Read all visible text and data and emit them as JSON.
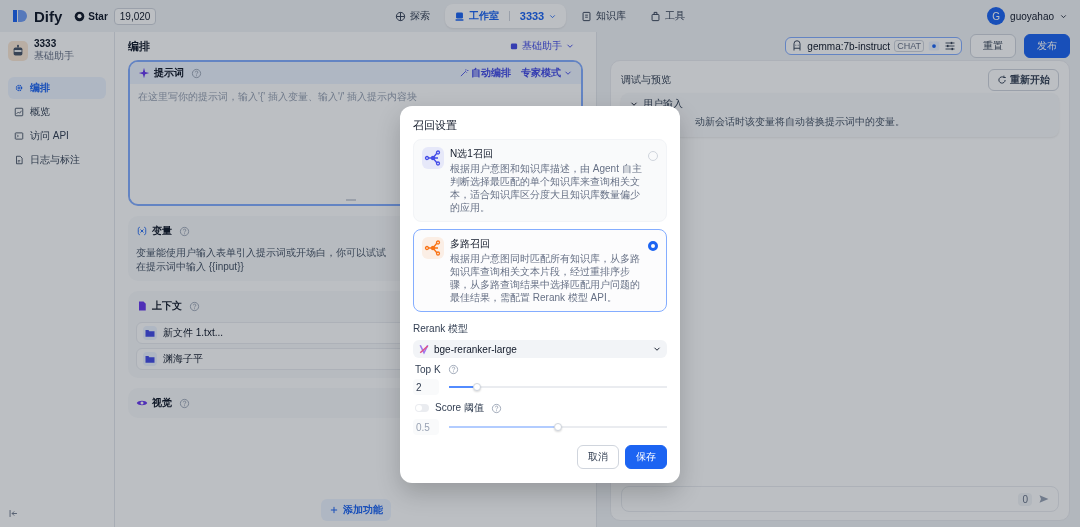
{
  "topbar": {
    "brand": "Dify",
    "star_label": "Star",
    "star_count": "19,020",
    "nav": [
      {
        "label": "探索",
        "selected": false,
        "kind": "explore"
      },
      {
        "label": "工作室",
        "selected": true,
        "kind": "studio",
        "app": "3333"
      },
      {
        "label": "知识库",
        "selected": false,
        "kind": "knowledge"
      },
      {
        "label": "工具",
        "selected": false,
        "kind": "tools"
      }
    ],
    "user": {
      "initial": "G",
      "name": "guoyahao"
    }
  },
  "app": {
    "name": "3333",
    "type": "基础助手"
  },
  "sidebar": {
    "items": [
      {
        "label": "编排",
        "selected": true,
        "kind": "orchestrate"
      },
      {
        "label": "概览",
        "selected": false,
        "kind": "overview"
      },
      {
        "label": "访问 API",
        "selected": false,
        "kind": "api"
      },
      {
        "label": "日志与标注",
        "selected": false,
        "kind": "logs"
      }
    ]
  },
  "editor": {
    "title": "编排",
    "mode": "基础助手",
    "prompt": {
      "title": "提示词",
      "auto": "自动编排",
      "expert": "专家模式",
      "placeholder": "在这里写你的提示词，输入'{' 插入变量、输入'/' 插入提示内容块"
    },
    "variables": {
      "title": "变量",
      "hint": "变量能使用户输入表单引入提示词或开场白，你可以试试在提示词中输入 {{input}}"
    },
    "context": {
      "title": "上下文",
      "items": [
        "新文件 1.txt...",
        "渊海子平"
      ]
    },
    "vision": {
      "title": "视觉"
    },
    "add_feature": "添加功能"
  },
  "header": {
    "model": "gemma:7b-instruct",
    "model_tag": "CHAT",
    "reset": "重置",
    "publish": "发布"
  },
  "preview": {
    "title": "调试与预览",
    "restart": "重新开始",
    "user_input": {
      "title": "用户输入",
      "hint": "动新会话时该变量将自动替换提示词中的变量。"
    },
    "counter": "0"
  },
  "dialog": {
    "title": "召回设置",
    "options": [
      {
        "title": "N选1召回",
        "desc": "根据用户意图和知识库描述，由 Agent 自主判断选择最匹配的单个知识库来查询相关文本，适合知识库区分度大且知识库数量偏少的应用。",
        "selected": false,
        "color": "#444ce7"
      },
      {
        "title": "多路召回",
        "desc": "根据用户意图同时匹配所有知识库，从多路知识库查询相关文本片段，经过重排序步骤，从多路查询结果中选择匹配用户问题的最佳结果，需配置 Rerank 模型 API。",
        "selected": true,
        "color": "#f97316"
      }
    ],
    "rerank_label": "Rerank 模型",
    "rerank_model": "bge-reranker-large",
    "top_k": {
      "label": "Top K",
      "value": "2",
      "level": 0.13
    },
    "score": {
      "label": "Score 阈值",
      "on": false,
      "value": "0.5",
      "level": 0.5
    },
    "cancel": "取消",
    "save": "保存"
  }
}
